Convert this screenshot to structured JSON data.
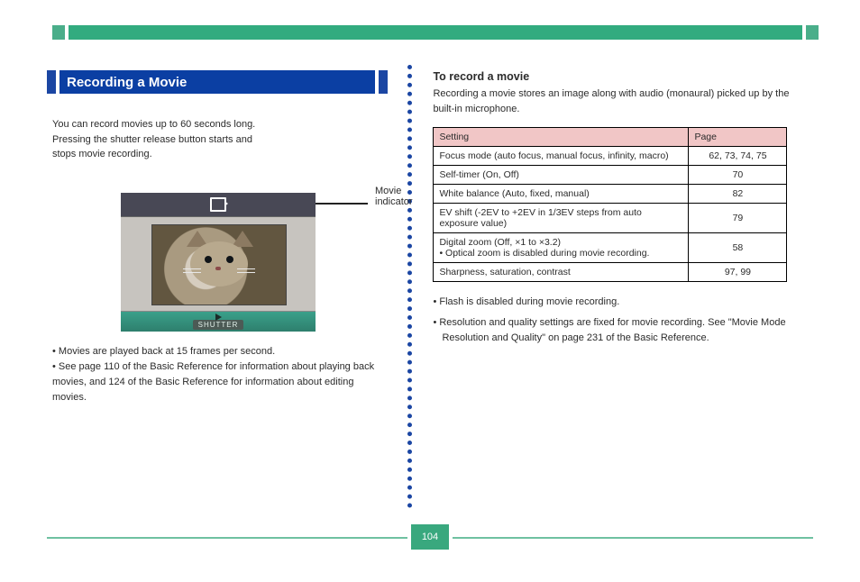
{
  "top_rule_label": "",
  "left": {
    "heading": "Recording a Movie",
    "p1a": "You can record movies up to 60 seconds long.",
    "p1b": "Pressing the shutter release button starts and",
    "p1c": "stops movie recording.",
    "callout1": "Movie",
    "callout2": "indicator",
    "shutter_label": "SHUTTER",
    "bullets": [
      "• Movies are played back at 15 frames per second.",
      "• See page 110 of the Basic Reference for information about playing back movies, and 124 of the Basic Reference for information about editing movies."
    ]
  },
  "right": {
    "h3": "To record a movie",
    "p1": "Recording a movie stores an image along with audio (monaural) picked up by the built-in microphone.",
    "table": {
      "headers": [
        "Setting",
        "Page"
      ],
      "rows": [
        [
          "Focus mode (auto focus, manual focus, infinity, macro)",
          "62, 73, 74, 75"
        ],
        [
          "Self-timer (On, Off)",
          "70"
        ],
        [
          "White balance (Auto, fixed, manual)",
          "82"
        ],
        [
          "EV shift (-2EV to +2EV in 1/3EV steps from auto exposure value)",
          "79"
        ],
        [
          "Digital zoom (Off, ×1 to ×3.2)\n• Optical zoom is disabled during movie recording.",
          "58"
        ],
        [
          "Sharpness, saturation, contrast",
          "97, 99"
        ]
      ]
    },
    "notes": [
      "• Flash is disabled during movie recording.",
      "• Resolution and quality settings are fixed for movie recording. See \"Movie Mode Resolution and Quality\" on page 231 of the Basic Reference."
    ]
  },
  "page_number": "104"
}
